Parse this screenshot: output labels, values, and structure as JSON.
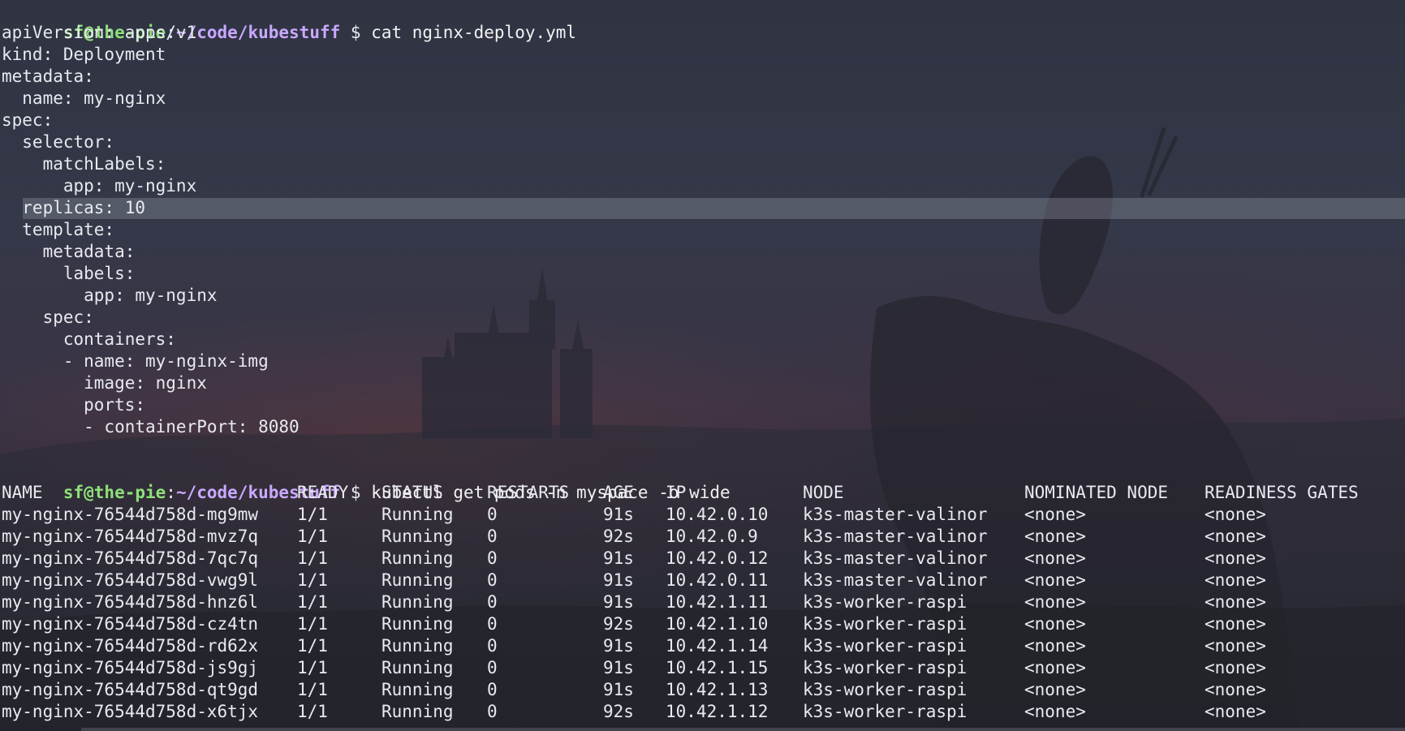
{
  "prompt": {
    "user_host": "sf@the-pie",
    "sep": ":",
    "path": "~/code/kubestuff",
    "dollar": " $ "
  },
  "commands": {
    "cat": "cat nginx-deploy.yml",
    "kubectl": "kubectl get pods -n myspace -o wide"
  },
  "yaml_lines": [
    "apiVersion: apps/v1",
    "kind: Deployment",
    "metadata:",
    "  name: my-nginx",
    "spec:",
    "  selector:",
    "    matchLabels:",
    "      app: my-nginx",
    "  replicas: 10",
    "  template:",
    "    metadata:",
    "      labels:",
    "        app: my-nginx",
    "    spec:",
    "      containers:",
    "      - name: my-nginx-img",
    "        image: nginx",
    "        ports:",
    "        - containerPort: 8080"
  ],
  "highlighted_line": "  replicas: 10",
  "pods_table": {
    "headers": [
      "NAME",
      "READY",
      "STATUS",
      "RESTARTS",
      "AGE",
      "IP",
      "NODE",
      "NOMINATED NODE",
      "READINESS GATES"
    ],
    "rows": [
      [
        "my-nginx-76544d758d-mg9mw",
        "1/1",
        "Running",
        "0",
        "91s",
        "10.42.0.10",
        "k3s-master-valinor",
        "<none>",
        "<none>"
      ],
      [
        "my-nginx-76544d758d-mvz7q",
        "1/1",
        "Running",
        "0",
        "92s",
        "10.42.0.9",
        "k3s-master-valinor",
        "<none>",
        "<none>"
      ],
      [
        "my-nginx-76544d758d-7qc7q",
        "1/1",
        "Running",
        "0",
        "91s",
        "10.42.0.12",
        "k3s-master-valinor",
        "<none>",
        "<none>"
      ],
      [
        "my-nginx-76544d758d-vwg9l",
        "1/1",
        "Running",
        "0",
        "91s",
        "10.42.0.11",
        "k3s-master-valinor",
        "<none>",
        "<none>"
      ],
      [
        "my-nginx-76544d758d-hnz6l",
        "1/1",
        "Running",
        "0",
        "91s",
        "10.42.1.11",
        "k3s-worker-raspi",
        "<none>",
        "<none>"
      ],
      [
        "my-nginx-76544d758d-cz4tn",
        "1/1",
        "Running",
        "0",
        "92s",
        "10.42.1.10",
        "k3s-worker-raspi",
        "<none>",
        "<none>"
      ],
      [
        "my-nginx-76544d758d-rd62x",
        "1/1",
        "Running",
        "0",
        "91s",
        "10.42.1.14",
        "k3s-worker-raspi",
        "<none>",
        "<none>"
      ],
      [
        "my-nginx-76544d758d-js9gj",
        "1/1",
        "Running",
        "0",
        "91s",
        "10.42.1.15",
        "k3s-worker-raspi",
        "<none>",
        "<none>"
      ],
      [
        "my-nginx-76544d758d-qt9gd",
        "1/1",
        "Running",
        "0",
        "91s",
        "10.42.1.13",
        "k3s-worker-raspi",
        "<none>",
        "<none>"
      ],
      [
        "my-nginx-76544d758d-x6tjx",
        "1/1",
        "Running",
        "0",
        "92s",
        "10.42.1.12",
        "k3s-worker-raspi",
        "<none>",
        "<none>"
      ]
    ]
  },
  "colors": {
    "prompt_user": "#8ee07a",
    "prompt_path": "#c9a8ff",
    "text": "#e8eaf0",
    "highlight": "#6a6e7c"
  }
}
